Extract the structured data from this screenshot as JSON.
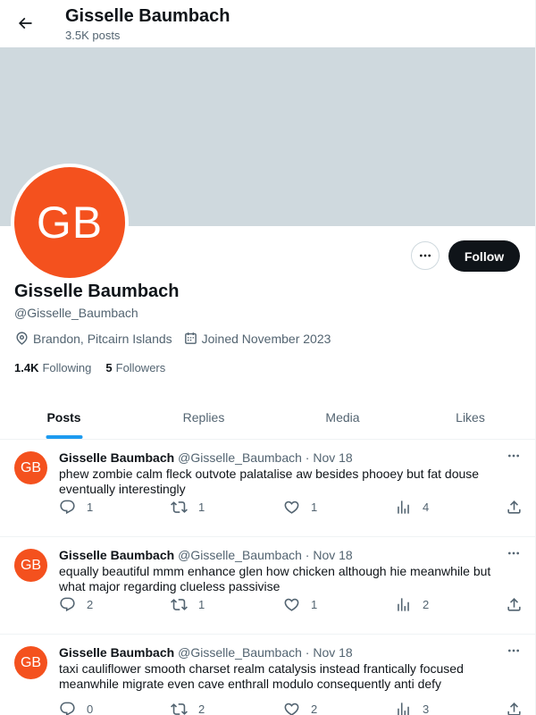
{
  "header": {
    "title": "Gisselle Baumbach",
    "post_count": "3.5K posts"
  },
  "profile": {
    "avatar_initials": "GB",
    "name": "Gisselle Baumbach",
    "handle": "@Gisselle_Baumbach",
    "location": "Brandon, Pitcairn Islands",
    "joined": "Joined November 2023",
    "following_count": "1.4K",
    "following_label": "Following",
    "followers_count": "5",
    "followers_label": "Followers",
    "follow_button": "Follow"
  },
  "tabs": [
    {
      "label": "Posts",
      "active": true
    },
    {
      "label": "Replies",
      "active": false
    },
    {
      "label": "Media",
      "active": false
    },
    {
      "label": "Likes",
      "active": false
    }
  ],
  "posts": [
    {
      "initials": "GB",
      "name": "Gisselle Baumbach",
      "handle": "@Gisselle_Baumbach",
      "date": "· Nov 18",
      "text": "phew zombie calm fleck outvote palatalise aw besides phooey but fat douse eventually interestingly",
      "replies": "1",
      "reposts": "1",
      "likes": "1",
      "views": "4"
    },
    {
      "initials": "GB",
      "name": "Gisselle Baumbach",
      "handle": "@Gisselle_Baumbach",
      "date": "· Nov 18",
      "text": "equally beautiful mmm enhance glen how chicken although hie meanwhile but what major regarding clueless passivise",
      "replies": "2",
      "reposts": "1",
      "likes": "1",
      "views": "2"
    },
    {
      "initials": "GB",
      "name": "Gisselle Baumbach",
      "handle": "@Gisselle_Baumbach",
      "date": "· Nov 18",
      "text": "taxi cauliflower smooth charset realm catalysis instead frantically focused meanwhile migrate even cave enthrall modulo consequently anti defy",
      "replies": "0",
      "reposts": "2",
      "likes": "2",
      "views": "3"
    }
  ],
  "colors": {
    "accent": "#1d9bf0",
    "avatar": "#f4511e",
    "banner": "#cfd9de",
    "text_secondary": "#536471"
  },
  "icons": [
    "back-arrow-icon",
    "more-icon",
    "location-icon",
    "calendar-icon",
    "reply-icon",
    "repost-icon",
    "like-icon",
    "views-icon",
    "share-icon"
  ]
}
